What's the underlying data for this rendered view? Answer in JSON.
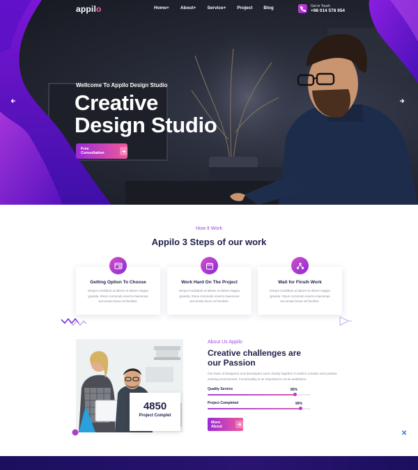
{
  "brand": {
    "logo_text": "appil",
    "logo_dot": "o",
    "accent_purple": "#8e1cd8",
    "accent_pink": "#f05a9a",
    "navy": "#1f1f4a"
  },
  "nav": {
    "items": [
      "Home+",
      "About+",
      "Service+",
      "Project",
      "Blog"
    ]
  },
  "call": {
    "icon": "phone-icon",
    "label": "Get in Touch",
    "number": "+98 014 578 954"
  },
  "hero": {
    "subtitle": "Wellcome To Appilo Design Studio",
    "title_line1": "Creative",
    "title_line2": "Design Studio",
    "cta_label": "Free Consultation",
    "cta_icon": "arrow-right-icon",
    "prev_icon": "arrow-left-icon",
    "next_icon": "arrow-right-icon"
  },
  "how": {
    "subtitle": "How It Work",
    "title": "Appilo 3 Steps of our work",
    "cards": [
      {
        "icon": "browser-icon",
        "title": "Getting Option To Choose",
        "text": "tempor incididunt ut labore et dolore magna gravida. Risus commodo viverra maecenas accumsan lacus vel facilisis."
      },
      {
        "icon": "calendar-icon",
        "title": "Work Hard On The Project",
        "text": "tempor incididunt ut labore et dolore magna gravida. Risus commodo viverra maecenas accumsan lacus vel facilisis."
      },
      {
        "icon": "network-icon",
        "title": "Wait for Finsih Work",
        "text": "tempor incididunt ut labore et dolore magna gravida. Risus commodo viverra maecenas accumsan lacus vel facilisis."
      }
    ]
  },
  "about": {
    "subtitle": "About Us Appilo",
    "title_line1": "Creative challenges are",
    "title_line2": "our Passion",
    "text": "Our team of designers and developers work closely together to build a creative and positive working environment. Functionality is as important to us as aesthetics.",
    "counter_value": "4850",
    "counter_label": "Project Complet",
    "skills": [
      {
        "label": "Quality Service",
        "value_text": "85%",
        "value": 85
      },
      {
        "label": "Project Completed",
        "value_text": "90%",
        "value": 90
      }
    ],
    "more_label": "More About",
    "more_icon": "arrow-right-icon",
    "close_icon": "close-icon"
  }
}
